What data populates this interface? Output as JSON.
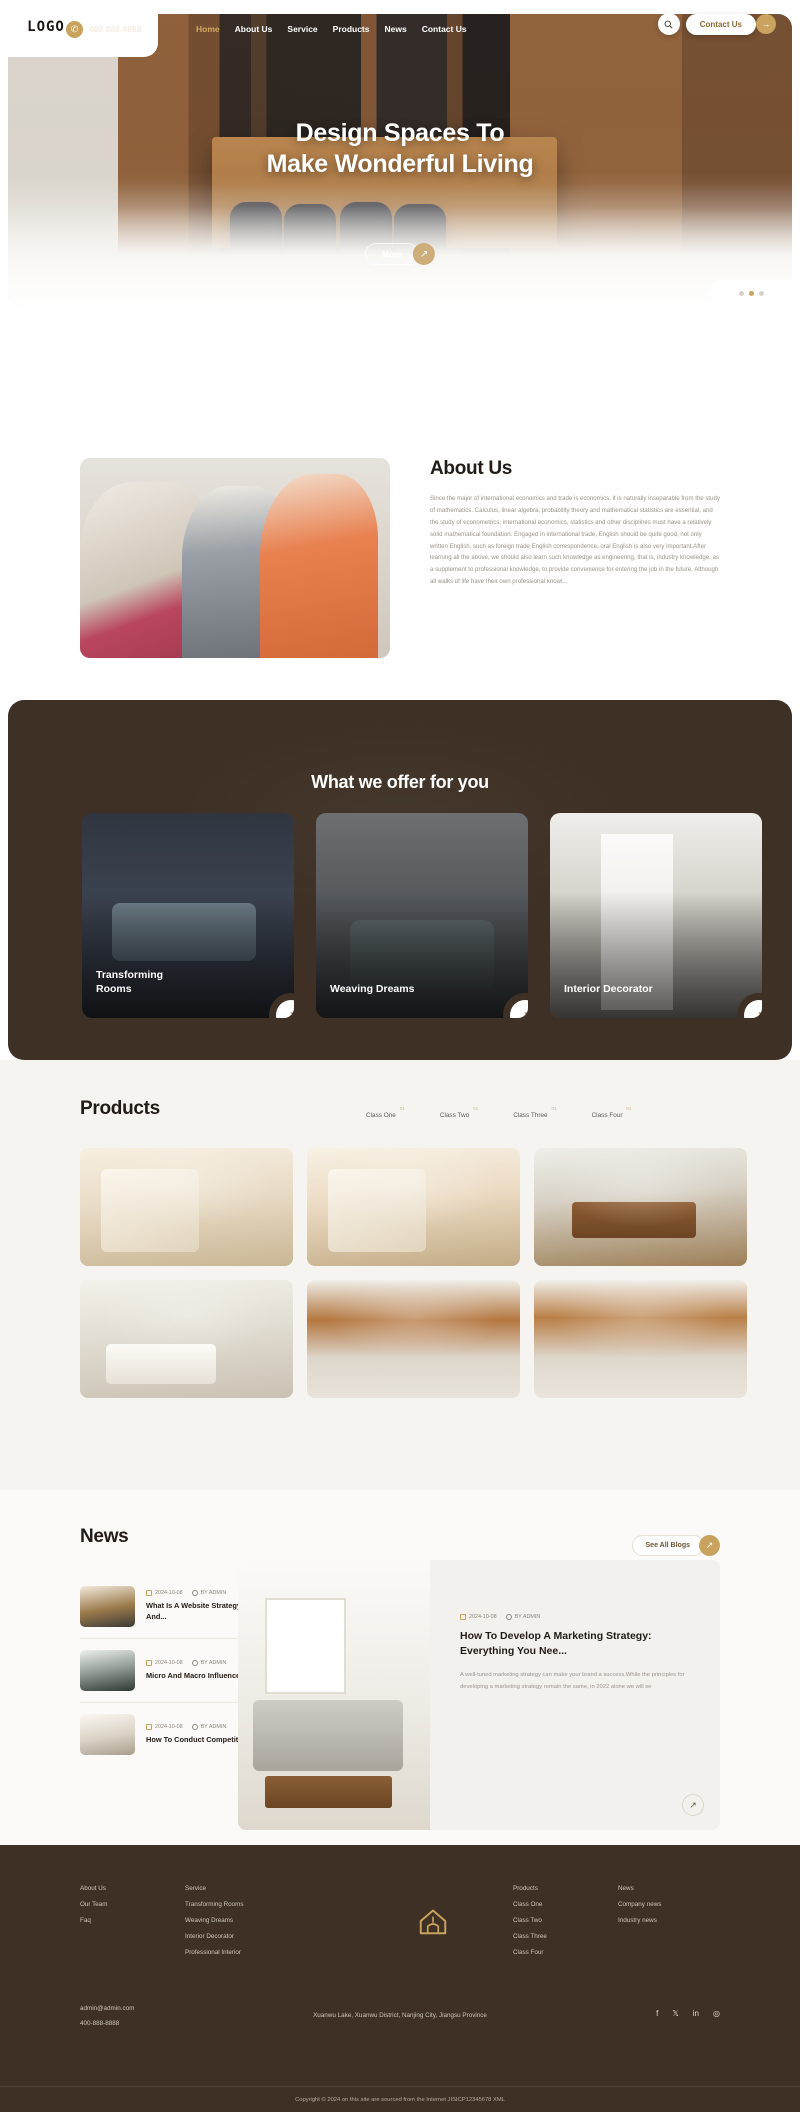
{
  "header": {
    "logo": "LOGO",
    "phone": "400-888-8888",
    "phone_icon": "phone-icon",
    "nav": [
      {
        "label": "Home",
        "active": true
      },
      {
        "label": "About Us",
        "active": false
      },
      {
        "label": "Service",
        "active": false
      },
      {
        "label": "Products",
        "active": false
      },
      {
        "label": "News",
        "active": false
      },
      {
        "label": "Contact Us",
        "active": false
      }
    ],
    "search_icon": "search-icon",
    "cta_label": "Contact Us",
    "cta_arrow_icon": "arrow-right-icon"
  },
  "hero": {
    "title_line1": "Design Spaces To",
    "title_line2": "Make Wonderful Living",
    "more_label": "More",
    "more_arrow_icon": "arrow-up-right-icon",
    "dots": 3
  },
  "about": {
    "heading": "About Us",
    "body": "Since the major of international economics and trade is economics, it is naturally inseparable from the study of mathematics. Calculus, linear algebra, probability theory and mathematical statistics are essential, and the study of econometrics, international economics, statistics and other disciplines must have a relatively solid mathematical foundation. Engaged in international trade, English should be quite good, not only written English, such as foreign trade English correspondence, oral English is also very important.After learning all the above, we should also learn such knowledge as engineering, that is, industry knowledge, as a supplement to professional knowledge, to provide convenience for entering the job in the future. Although all walks of life have their own professional knowl..."
  },
  "offer": {
    "heading": "What we offer for you",
    "cards": [
      {
        "title": "Transforming\nRooms",
        "fab_icon": "arrow-up-right-icon"
      },
      {
        "title": "Weaving Dreams",
        "fab_icon": "arrow-up-right-icon"
      },
      {
        "title": "Interior Decorator",
        "fab_icon": "arrow-up-right-icon"
      }
    ]
  },
  "products": {
    "heading": "Products",
    "classes": [
      {
        "label": "Class One",
        "index": "01"
      },
      {
        "label": "Class Two",
        "index": "01"
      },
      {
        "label": "Class Three",
        "index": "01"
      },
      {
        "label": "Class Four",
        "index": "01"
      }
    ],
    "tiles": [
      "product-1",
      "product-2",
      "product-3",
      "product-4",
      "product-5",
      "product-6"
    ]
  },
  "news": {
    "heading": "News",
    "see_all_label": "See All Blogs",
    "see_all_arrow_icon": "arrow-up-right-icon",
    "items": [
      {
        "date": "2024-10-08",
        "author": "BY ADMIN",
        "title": "What Is A Website Strategy? Why Do You Need It And..."
      },
      {
        "date": "2024-10-08",
        "author": "BY ADMIN",
        "title": "Micro And Macro Influencers: How Do They..."
      },
      {
        "date": "2024-10-08",
        "author": "BY ADMIN",
        "title": "How To Conduct Competitive Pricing Analysis"
      }
    ],
    "feature": {
      "date": "2024-10-08",
      "author": "BY ADMIN",
      "title": "How To Develop A Marketing Strategy: Everything You Nee...",
      "desc": "A well-tuned marketing strategy can make your brand a success.While the principles for developing a marketing strategy remain the same, in 2022 alone we will se",
      "fab_icon": "arrow-up-right-icon"
    }
  },
  "footer": {
    "col1": [
      "About Us",
      "Our Team",
      "Faq"
    ],
    "col2": [
      "Service",
      "Transforming Rooms",
      "Weaving Dreams",
      "Interior Decorator",
      "Professional Interior"
    ],
    "logo_icon": "house-icon",
    "col4": [
      "Products",
      "Class One",
      "Class Two",
      "Class Three",
      "Class Four"
    ],
    "col5": [
      "News",
      "Company news",
      "Industry news"
    ],
    "email": "admin@admin.com",
    "phone": "400-888-8888",
    "address": "Xuanwu Lake, Xuanwu District, Nanjing City, Jiangsu Province",
    "social": [
      "facebook-icon",
      "x-icon",
      "linkedin-icon",
      "instagram-icon"
    ],
    "social_glyphs": [
      "f",
      "𝕏",
      "in",
      "◎"
    ],
    "copyright": "Copyright © 2024 on this site are sourced from the Internet JISICP12345678 XML"
  },
  "colors": {
    "brand_gold": "#c9a35e",
    "dark_brown": "#3e3024",
    "text_dark": "#231b16"
  }
}
